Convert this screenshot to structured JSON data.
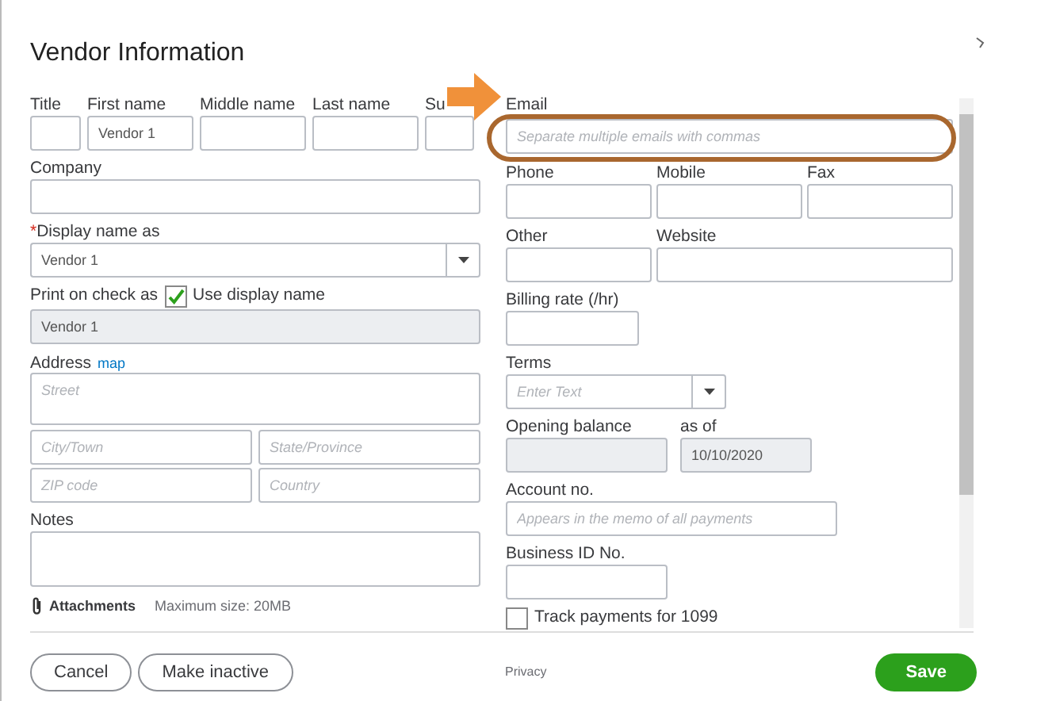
{
  "title": "Vendor Information",
  "name_row": [
    {
      "label": "Title"
    },
    {
      "label": "First name",
      "value": "Vendor 1"
    },
    {
      "label": "Middle name"
    },
    {
      "label": "Last name"
    },
    {
      "label": "Su"
    }
  ],
  "company": {
    "label": "Company"
  },
  "display_name": {
    "required_mark": "*",
    "label": "Display name as",
    "value": "Vendor 1"
  },
  "print_on_check": {
    "label": "Print on check as",
    "checkbox_label": "Use display name",
    "checked": true,
    "value": "Vendor 1",
    "disabled": true
  },
  "address": {
    "label": "Address",
    "link": "map",
    "street_placeholder": "Street",
    "fields": [
      {
        "placeholder": "City/Town"
      },
      {
        "placeholder": "State/Province"
      },
      {
        "placeholder": "ZIP code"
      },
      {
        "placeholder": "Country"
      }
    ]
  },
  "notes": {
    "label": "Notes"
  },
  "attachments": {
    "label": "Attachments",
    "note": "Maximum size: 20MB"
  },
  "email": {
    "label": "Email",
    "placeholder": "Separate multiple emails with commas"
  },
  "contact_row": [
    {
      "label": "Phone"
    },
    {
      "label": "Mobile"
    },
    {
      "label": "Fax"
    }
  ],
  "other_row": [
    {
      "label": "Other"
    },
    {
      "label": "Website"
    }
  ],
  "billing_rate": {
    "label": "Billing rate (/hr)"
  },
  "terms": {
    "label": "Terms",
    "placeholder": "Enter Text"
  },
  "opening_balance": {
    "label": "Opening balance",
    "disabled": true
  },
  "as_of": {
    "label": "as of",
    "value": "10/10/2020",
    "disabled": true
  },
  "account_no": {
    "label": "Account no.",
    "placeholder": "Appears in the memo of all payments"
  },
  "business_id": {
    "label": "Business ID No."
  },
  "track_1099": {
    "label": "Track payments for 1099",
    "checked": false
  },
  "footer": {
    "cancel": "Cancel",
    "make_inactive": "Make inactive",
    "privacy": "Privacy",
    "save": "Save"
  }
}
